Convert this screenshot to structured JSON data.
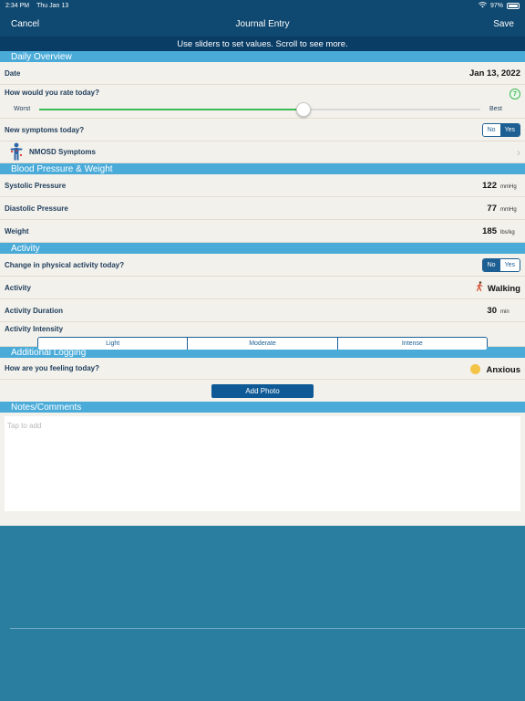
{
  "status_bar": {
    "time": "2:34 PM",
    "date": "Thu Jan 13",
    "battery": "97%",
    "battery_level": 0.97
  },
  "nav": {
    "cancel": "Cancel",
    "title": "Journal Entry",
    "save": "Save"
  },
  "hint": "Use sliders to set values. Scroll to see more.",
  "daily_overview": {
    "header": "Daily Overview",
    "date_label": "Date",
    "date_value": "Jan 13, 2022",
    "rating_question": "How would you rate today?",
    "rating_value": "7",
    "rating_fraction": 0.6,
    "slider_min": "Worst",
    "slider_max": "Best",
    "symptoms_question": "New symptoms today?",
    "no": "No",
    "yes": "Yes",
    "nmosd": "NMOSD Symptoms"
  },
  "bp": {
    "header": "Blood Pressure & Weight",
    "systolic_label": "Systolic Pressure",
    "systolic_value": "122",
    "systolic_unit": "mmHg",
    "diastolic_label": "Diastolic Pressure",
    "diastolic_value": "77",
    "diastolic_unit": "mmHg",
    "weight_label": "Weight",
    "weight_value": "185",
    "weight_unit": "lbs/kg"
  },
  "activity": {
    "header": "Activity",
    "change_question": "Change in physical activity today?",
    "no": "No",
    "yes": "Yes",
    "activity_label": "Activity",
    "activity_value": "Walking",
    "duration_label": "Activity Duration",
    "duration_value": "30",
    "duration_unit": "min",
    "intensity_label": "Activity Intensity",
    "intensity_options": [
      "Light",
      "Moderate",
      "Intense"
    ]
  },
  "additional": {
    "header": "Additional Logging",
    "feeling_question": "How are you feeling today?",
    "feeling_value": "Anxious",
    "add_photo": "Add Photo"
  },
  "notes": {
    "header": "Notes/Comments",
    "placeholder": "Tap to add"
  },
  "colors": {
    "nav": "#0f4870",
    "section": "#4aabd9",
    "accent_green": "#3cba54",
    "button": "#0f5a96"
  }
}
